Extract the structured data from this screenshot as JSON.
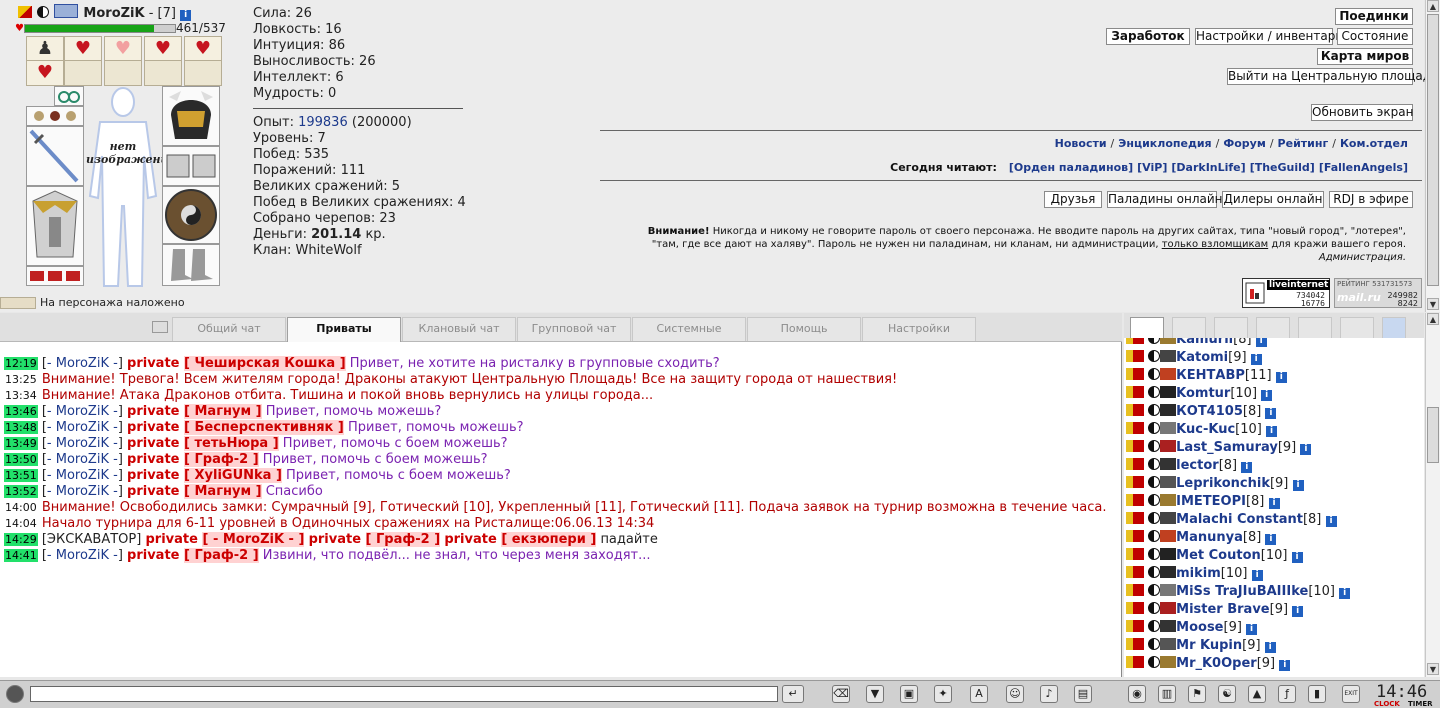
{
  "character": {
    "name": "MoroZiK",
    "level_text": "- [7]",
    "hp": "461/537",
    "hp_fraction": 0.86,
    "no_image_label": "нет изображения",
    "curse_text": "На персонажа наложено"
  },
  "stats": {
    "strength": "Сила: 26",
    "agility": "Ловкость: 16",
    "intuition": "Интуиция: 86",
    "endurance": "Выносливость: 26",
    "intellect": "Интеллект: 6",
    "wisdom": "Мудрость: 0",
    "exp_label": "Опыт:",
    "exp_value": "199836",
    "exp_next": "(200000)",
    "level": "Уровень: 7",
    "wins": "Побед: 535",
    "losses": "Поражений: 111",
    "great_battles": "Великих сражений: 5",
    "great_wins": "Побед в Великих сражениях: 4",
    "skulls": "Собрано черепов: 23",
    "money_label": "Деньги:",
    "money_value": "201.14",
    "money_unit": "кр.",
    "clan": "Клан: WhiteWolf"
  },
  "menu": {
    "duels": "Поединки",
    "earnings": "Заработок",
    "settings_inventory": "Настройки / инвентарь",
    "state": "Состояние",
    "world_map": "Карта миров",
    "central_square": "Выйти на Центральную площадь",
    "refresh": "Обновить экран"
  },
  "nav_links": [
    "Новости",
    "Энциклопедия",
    "Форум",
    "Рейтинг",
    "Ком.отдел"
  ],
  "reading": {
    "label": "Сегодня читают:",
    "clans": [
      "[Орден паладинов]",
      "[ViP]",
      "[DarkInLife]",
      "[TheGuild]",
      "[FallenAngels]"
    ]
  },
  "social_buttons": [
    "Друзья",
    "Паладины онлайн",
    "Дилеры онлайн",
    "RDJ в эфире"
  ],
  "warning": {
    "bold": "Внимание!",
    "line1": " Никогда и никому не говорите пароль от своего персонажа. Не вводите пароль на других сайтах, типа \"новый город\", \"лотерея\",",
    "line2a": "\"там, где все дают на халяву\". Пароль не нужен ни паладинам, ни кланам, ни администрации, ",
    "line2u": "только взломщикам",
    "line2b": " для кражи вашего героя.",
    "sign": "Администрация."
  },
  "counters": {
    "li_title": "liveinternet",
    "li_n1": "734042",
    "li_n2": "16776",
    "mr_title": "РЕЙТИНГ 531731573",
    "mr_n1": "249982",
    "mr_n2": "8242",
    "mr_logo": "mail.ru"
  },
  "tabs": [
    "Общий чат",
    "Приваты",
    "Клановый чат",
    "Групповой чат",
    "Системные",
    "Помощь",
    "Настройки"
  ],
  "chat": [
    {
      "time": "12:19",
      "hl": true,
      "type": "priv",
      "nick": "MoroZiK",
      "to": [
        "Чеширская Кошка"
      ],
      "text": "Привет, не хотите на ристалку в групповые сходить?"
    },
    {
      "time": "13:25",
      "hl": false,
      "type": "sys",
      "text": "Внимание! Тревога! Всем жителям города! Драконы атакуют Центральную Площадь! Все на защиту города от нашествия!"
    },
    {
      "time": "13:34",
      "hl": false,
      "type": "sys",
      "text": "Внимание! Атака Драконов отбита. Тишина и покой вновь вернулись на улицы города..."
    },
    {
      "time": "13:46",
      "hl": true,
      "type": "priv",
      "nick": "MoroZiK",
      "to": [
        "Магнум"
      ],
      "text": "Привет, помочь можешь?"
    },
    {
      "time": "13:48",
      "hl": true,
      "type": "priv",
      "nick": "MoroZiK",
      "to": [
        "Бесперспективняк"
      ],
      "text": "Привет, помочь можешь?"
    },
    {
      "time": "13:49",
      "hl": true,
      "type": "priv",
      "nick": "MoroZiK",
      "to": [
        "тетьНюра"
      ],
      "text": "Привет, помочь с боем можешь?"
    },
    {
      "time": "13:50",
      "hl": true,
      "type": "priv",
      "nick": "MoroZiK",
      "to": [
        "Граф-2"
      ],
      "text": "Привет, помочь с боем можешь?"
    },
    {
      "time": "13:51",
      "hl": true,
      "type": "priv",
      "nick": "MoroZiK",
      "to": [
        "XyliGUNka"
      ],
      "text": "Привет, помочь с боем можешь?"
    },
    {
      "time": "13:52",
      "hl": true,
      "type": "priv",
      "nick": "MoroZiK",
      "to": [
        "Магнум"
      ],
      "text": "Спасибо"
    },
    {
      "time": "14:00",
      "hl": false,
      "type": "sys",
      "text": "Внимание! Освободились замки: Сумрачный [9], Готический [10], Укрепленный [11], Готический [11]. Подача заявок на турнир возможна в течение часа."
    },
    {
      "time": "14:04",
      "hl": false,
      "type": "sys",
      "text": "Начало турнира для 6-11 уровней в Одиночных сражениях на Ристалище:06.06.13 14:34"
    },
    {
      "time": "14:29",
      "hl": true,
      "type": "multi",
      "nick": "ЭКСКАВАТОР",
      "to": [
        "- MoroZiK -",
        "Граф-2",
        "екзюпери"
      ],
      "text": "падайте"
    },
    {
      "time": "14:41",
      "hl": true,
      "type": "priv",
      "nick": "MoroZiK",
      "to": [
        "Граф-2"
      ],
      "text": "Извини, что подвёл... не знал, что через меня заходят..."
    }
  ],
  "users": [
    {
      "name": "Kamurii",
      "level": "[8]",
      "info": true
    },
    {
      "name": "Katomi",
      "level": "[9]",
      "info": true
    },
    {
      "name": "КЕНТАВР",
      "level": "[11]",
      "info": true
    },
    {
      "name": "Komtur",
      "level": "[10]",
      "info": true
    },
    {
      "name": "КОТ4105",
      "level": "[8]",
      "info": true
    },
    {
      "name": "Kuc-Kuc",
      "level": "[10]",
      "info": true
    },
    {
      "name": "Last_Samuray",
      "level": "[9]",
      "info": true
    },
    {
      "name": "lector",
      "level": "[8]",
      "info": true
    },
    {
      "name": "Leprikonchik",
      "level": "[9]",
      "info": true
    },
    {
      "name": "IMETEOPI",
      "level": "[8]",
      "info": true
    },
    {
      "name": "Malachi Constant",
      "level": "[8]",
      "info": true
    },
    {
      "name": "Manunya",
      "level": "[8]",
      "info": true
    },
    {
      "name": "Met Couton",
      "level": "[10]",
      "info": true
    },
    {
      "name": "mikim",
      "level": "[10]",
      "info": true
    },
    {
      "name": "MiSs TraJIuBAIIIke",
      "level": "[10]",
      "info": true
    },
    {
      "name": "Mister Brave",
      "level": "[9]",
      "info": true
    },
    {
      "name": "Moose",
      "level": "[9]",
      "info": true
    },
    {
      "name": "Mr Kupin",
      "level": "[9]",
      "info": true
    },
    {
      "name": "Mr_K0Oper",
      "level": "[9]",
      "info": true
    }
  ],
  "input": {
    "value": ""
  },
  "clock": {
    "time": "14:46",
    "label_left": "CLOCK",
    "label_right": "TIMER",
    "exit": "EXIT"
  }
}
